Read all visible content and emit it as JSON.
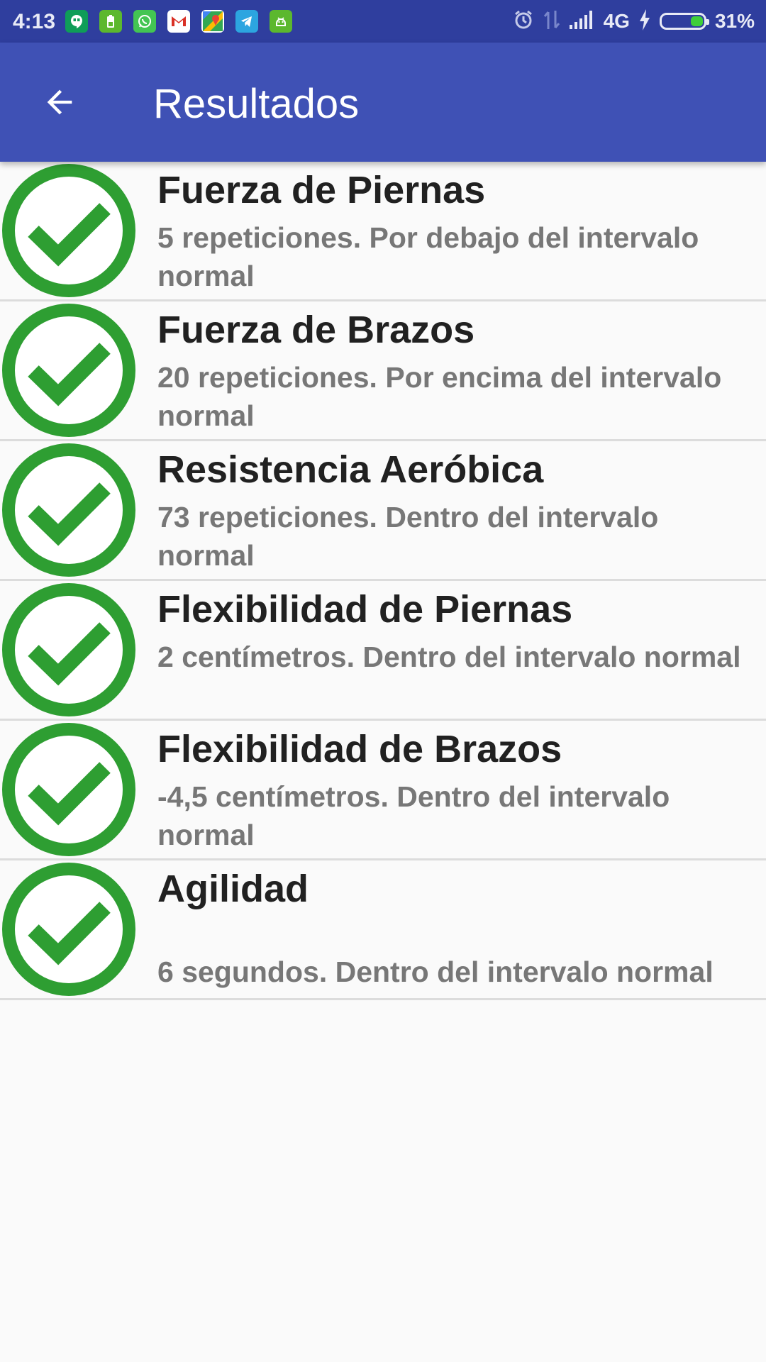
{
  "status_bar": {
    "time": "4:13",
    "network": "4G",
    "battery_percent": "31%",
    "battery_level": 0.31,
    "notification_icons": [
      "hangouts-icon",
      "battery-saver-icon",
      "whatsapp-icon",
      "gmail-icon",
      "maps-icon",
      "telegram-icon",
      "android-icon"
    ],
    "system_icons": [
      "alarm-icon",
      "data-transfer-icon",
      "signal-icon",
      "charging-icon",
      "battery-icon"
    ]
  },
  "app_bar": {
    "title": "Resultados",
    "back_icon": "arrow-back-icon",
    "color": "#3f51b5",
    "status_bar_color": "#2f3e9e"
  },
  "results": [
    {
      "title": "Fuerza de Piernas",
      "description": "5 repeticiones. Por debajo del intervalo normal",
      "status_icon": "check-circle-icon"
    },
    {
      "title": "Fuerza de Brazos",
      "description": "20 repeticiones. Por encima del intervalo normal",
      "status_icon": "check-circle-icon"
    },
    {
      "title": "Resistencia Aeróbica",
      "description": "73 repeticiones. Dentro del intervalo normal",
      "status_icon": "check-circle-icon"
    },
    {
      "title": "Flexibilidad de Piernas",
      "description": "2 centímetros. Dentro del intervalo normal",
      "status_icon": "check-circle-icon"
    },
    {
      "title": "Flexibilidad de Brazos",
      "description": "-4,5 centímetros. Dentro del intervalo normal",
      "status_icon": "check-circle-icon"
    },
    {
      "title": "Agilidad",
      "description": "6 segundos. Dentro del intervalo normal",
      "status_icon": "check-circle-icon"
    }
  ],
  "colors": {
    "check_green": "#2e9e32",
    "title_text": "#212121",
    "description_text": "#777777",
    "divider": "#dcdcdc",
    "background": "#fafafa"
  }
}
